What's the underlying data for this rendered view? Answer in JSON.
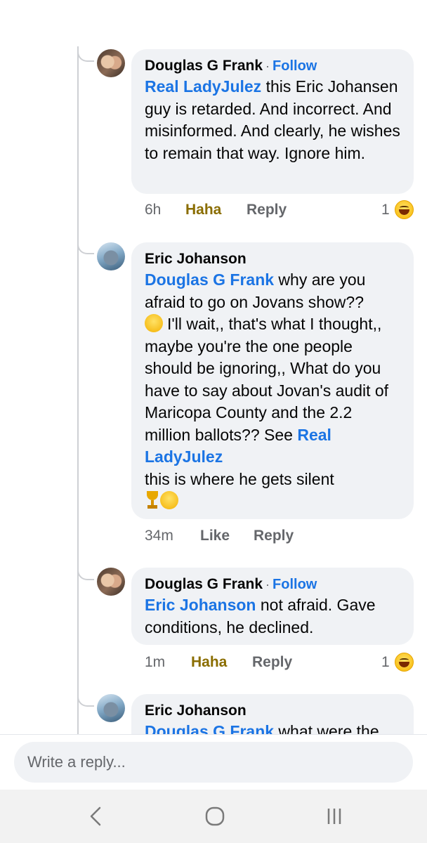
{
  "comments": [
    {
      "author": "Douglas G Frank",
      "follow": "Follow",
      "mention": "Real LadyJulez",
      "text": " this Eric Johansen guy is retarded. And incorrect. And misinformed. And clearly, he wishes to remain that way. Ignore him.",
      "time": "6h",
      "reaction_label": "Haha",
      "reply_label": "Reply",
      "reaction_count": "1"
    },
    {
      "author": "Eric Johanson",
      "mention": "Douglas G Frank",
      "text_part1": " why are you afraid to go on Jovans show??",
      "text_part2": "I'll wait,, that's what I thought,, maybe you're the one people should be ignoring,, What do you have to say about Jovan's audit of Maricopa County and the 2.2 million ballots?? See ",
      "mention2": "Real LadyJulez",
      "text_part3": "this is where he gets silent",
      "time": "34m",
      "like_label": "Like",
      "reply_label": "Reply"
    },
    {
      "author": "Douglas G Frank",
      "follow": "Follow",
      "mention": "Eric Johanson",
      "text": " not afraid. Gave conditions, he declined.",
      "time": "1m",
      "reaction_label": "Haha",
      "reply_label": "Reply",
      "reaction_count": "1"
    },
    {
      "author": "Eric Johanson",
      "mention": "Douglas G Frank",
      "text": " what were the"
    }
  ],
  "reply_box": {
    "placeholder": "Write a reply..."
  },
  "colors": {
    "link": "#1b74e4",
    "bubble": "#f0f2f5",
    "haha": "#8a6d00",
    "meta": "#65676b"
  },
  "icons": [
    "haha-reaction-icon",
    "thinking-face-icon",
    "trophy-icon",
    "laughing-face-icon",
    "back-icon",
    "home-icon",
    "recent-apps-icon"
  ]
}
